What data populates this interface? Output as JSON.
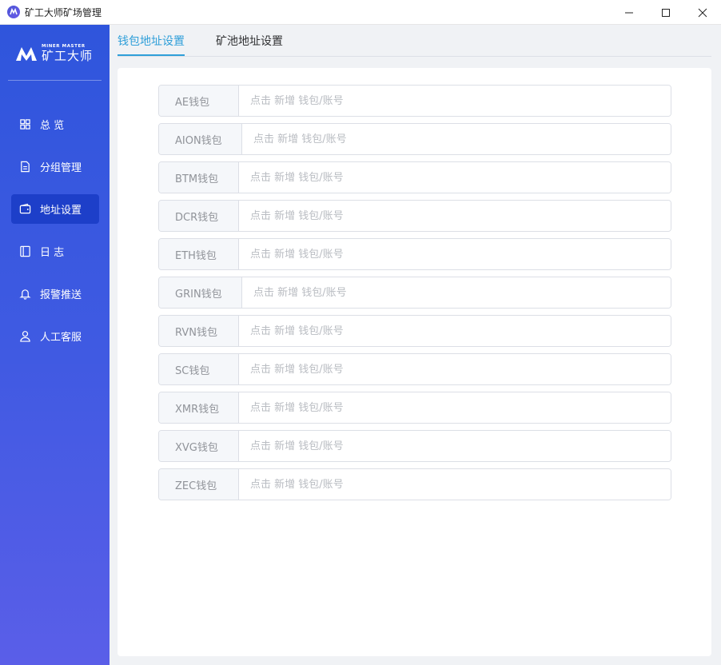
{
  "window": {
    "title": "矿工大师矿场管理"
  },
  "brand": {
    "en": "MINER MASTER",
    "cn": "矿工大师"
  },
  "sidebar": {
    "items": [
      {
        "label": "总 览",
        "icon": "grid-icon",
        "active": false
      },
      {
        "label": "分组管理",
        "icon": "document-icon",
        "active": false
      },
      {
        "label": "地址设置",
        "icon": "wallet-icon",
        "active": true
      },
      {
        "label": "日 志",
        "icon": "log-panel-icon",
        "active": false
      },
      {
        "label": "报警推送",
        "icon": "bell-icon",
        "active": false
      },
      {
        "label": "人工客服",
        "icon": "user-icon",
        "active": false
      }
    ]
  },
  "tabs": [
    {
      "label": "钱包地址设置",
      "active": true
    },
    {
      "label": "矿池地址设置",
      "active": false
    }
  ],
  "wallets": [
    {
      "label": "AE钱包",
      "placeholder": "点击 新增 钱包/账号"
    },
    {
      "label": "AION钱包",
      "placeholder": "点击 新增 钱包/账号"
    },
    {
      "label": "BTM钱包",
      "placeholder": "点击 新增 钱包/账号"
    },
    {
      "label": "DCR钱包",
      "placeholder": "点击 新增 钱包/账号"
    },
    {
      "label": "ETH钱包",
      "placeholder": "点击 新增 钱包/账号"
    },
    {
      "label": "GRIN钱包",
      "placeholder": "点击 新增 钱包/账号"
    },
    {
      "label": "RVN钱包",
      "placeholder": "点击 新增 钱包/账号"
    },
    {
      "label": "SC钱包",
      "placeholder": "点击 新增 钱包/账号"
    },
    {
      "label": "XMR钱包",
      "placeholder": "点击 新增 钱包/账号"
    },
    {
      "label": "XVG钱包",
      "placeholder": "点击 新增 钱包/账号"
    },
    {
      "label": "ZEC钱包",
      "placeholder": "点击 新增 钱包/账号"
    }
  ],
  "colors": {
    "accent": "#2f9fd9",
    "sidebar_top": "#2f55dc",
    "sidebar_bottom": "#5a5ee8",
    "active_nav": "#1d3fc9"
  }
}
